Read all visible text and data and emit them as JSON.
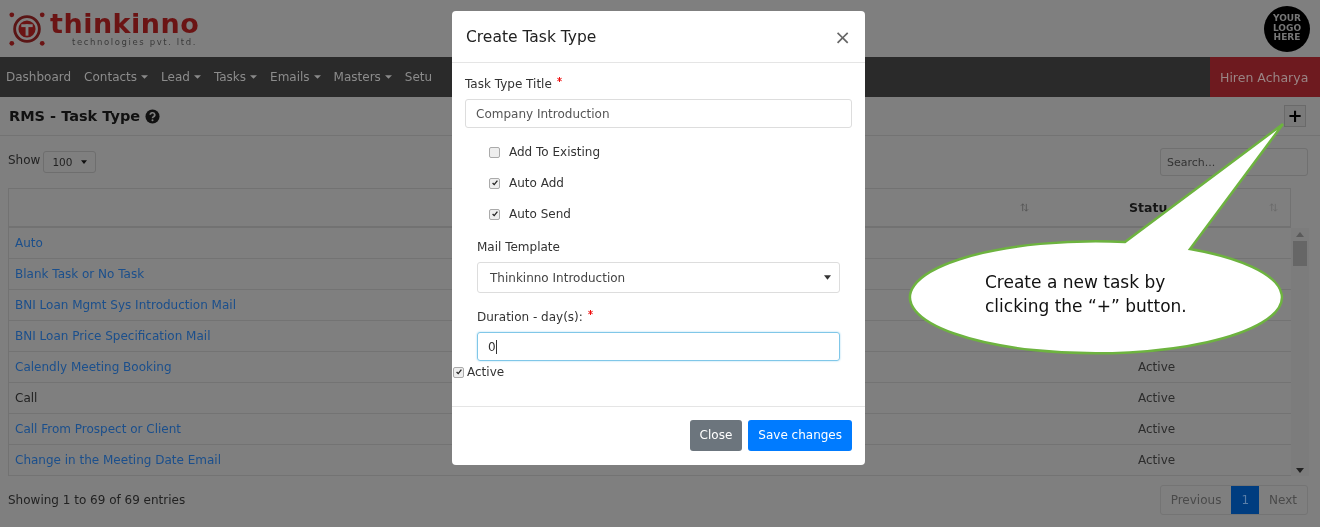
{
  "header": {
    "brand": "thinkinno",
    "tagline": "technologies pvt. ltd.",
    "client_logo": [
      "YOUR",
      "LOGO",
      "HERE"
    ]
  },
  "nav": {
    "items": [
      {
        "label": "Dashboard",
        "dropdown": false
      },
      {
        "label": "Contacts",
        "dropdown": true
      },
      {
        "label": "Lead",
        "dropdown": true
      },
      {
        "label": "Tasks",
        "dropdown": true
      },
      {
        "label": "Emails",
        "dropdown": true
      },
      {
        "label": "Masters",
        "dropdown": true
      },
      {
        "label": "Setu",
        "dropdown": false
      }
    ],
    "user": "Hiren Acharya"
  },
  "page": {
    "title": "RMS - Task Type",
    "add_button": "+",
    "show_label": "Show",
    "page_size": "100",
    "search_placeholder": "Search..."
  },
  "table": {
    "status_heading": "Statu",
    "rows": [
      {
        "name": "Auto",
        "linked": true
      },
      {
        "name": "Blank Task or No Task",
        "linked": true
      },
      {
        "name": "BNI Loan Mgmt Sys Introduction Mail",
        "linked": true
      },
      {
        "name": "BNI Loan Price Specification Mail",
        "linked": true
      },
      {
        "name": "Calendly Meeting Booking",
        "linked": true,
        "status": "Active"
      },
      {
        "name": "Call",
        "linked": false,
        "status": "Active"
      },
      {
        "name": "Call From Prospect or Client",
        "linked": true,
        "status": "Active"
      },
      {
        "name": "Change in the Meeting Date Email",
        "linked": true,
        "status": "Active"
      }
    ]
  },
  "footer": {
    "info": "Showing 1 to 69 of 69 entries",
    "pagination": [
      {
        "label": "Previous",
        "selected": false
      },
      {
        "label": "1",
        "selected": true
      },
      {
        "label": "Next",
        "selected": false
      }
    ]
  },
  "modal": {
    "title": "Create Task Type",
    "close": "×",
    "title_label": "Task Type Title",
    "title_required": true,
    "title_value": "Company Introduction",
    "options": [
      {
        "label": "Add To Existing",
        "checked": false
      },
      {
        "label": "Auto Add",
        "checked": true
      },
      {
        "label": "Auto Send",
        "checked": true
      }
    ],
    "template_label": "Mail Template",
    "template_value": "Thinkinno Introduction",
    "duration_label": "Duration - day(s):",
    "duration_required": true,
    "duration_value": "0",
    "active_label": "Active",
    "active": true,
    "buttons": [
      {
        "label": "Close",
        "kind": "secondary"
      },
      {
        "label": "Save changes",
        "kind": "primary"
      }
    ]
  },
  "callout": {
    "lines": [
      "Create a new task by",
      "clicking the “+” button."
    ]
  }
}
